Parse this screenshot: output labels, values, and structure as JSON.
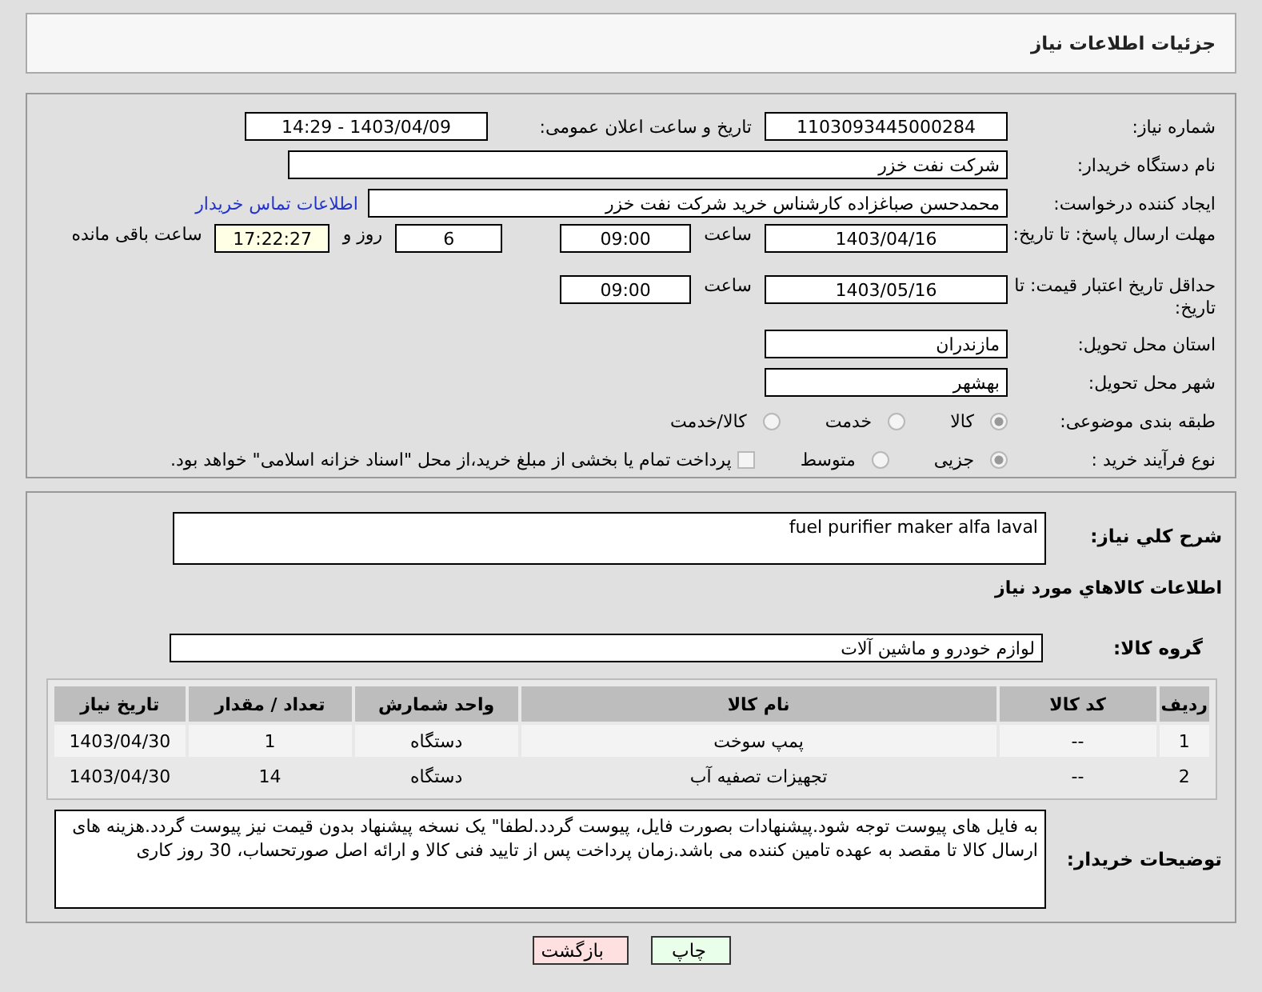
{
  "header": {
    "title": "جزئیات اطلاعات نیاز"
  },
  "need_number": {
    "label": "شماره نیاز:",
    "value": "1103093445000284"
  },
  "announce": {
    "label": "تاریخ و ساعت اعلان عمومی:",
    "value": "1403/04/09 - 14:29"
  },
  "buyer": {
    "label": "نام دستگاه خریدار:",
    "value": "شرکت نفت خزر"
  },
  "creator": {
    "label": "ایجاد کننده درخواست:",
    "value": "محمدحسن صباغزاده کارشناس خرید شرکت نفت خزر",
    "link": "اطلاعات تماس خریدار"
  },
  "reply_deadline": {
    "label": "مهلت ارسال پاسخ: تا تاریخ:",
    "date": "1403/04/16",
    "time_label": "ساعت",
    "time": "09:00",
    "days": "6",
    "days_label": "روز و",
    "remaining": "17:22:27",
    "remaining_label": "ساعت باقی مانده"
  },
  "price_validity": {
    "label": "حداقل تاریخ اعتبار قیمت: تا تاریخ:",
    "date": "1403/05/16",
    "time_label": "ساعت",
    "time": "09:00"
  },
  "province": {
    "label": "استان محل تحویل:",
    "value": "مازندران"
  },
  "city": {
    "label": "شهر محل تحویل:",
    "value": "بهشهر"
  },
  "category": {
    "label": "طبقه بندی موضوعی:",
    "options": [
      {
        "label": "کالا",
        "selected": true
      },
      {
        "label": "خدمت",
        "selected": false
      },
      {
        "label": "کالا/خدمت",
        "selected": false
      }
    ]
  },
  "purchase_type": {
    "label": "نوع فرآیند خرید :",
    "options": [
      {
        "label": "جزیی",
        "selected": true
      },
      {
        "label": "متوسط",
        "selected": false
      }
    ],
    "treasury": {
      "label": "پرداخت تمام یا بخشی از مبلغ خرید،از محل \"اسناد خزانه اسلامی\" خواهد بود.",
      "checked": false
    }
  },
  "description": {
    "label": "شرح کلي نیاز:",
    "value": "fuel purifier maker alfa laval"
  },
  "goods_heading": "اطلاعات کالاهاي مورد نیاز",
  "goods_group": {
    "label": "گروه کالا:",
    "value": "لوازم خودرو و ماشین آلات"
  },
  "table": {
    "columns": [
      "ردیف",
      "کد کالا",
      "نام کالا",
      "واحد شمارش",
      "تعداد / مقدار",
      "تاریخ نیاز"
    ],
    "rows": [
      [
        "1",
        "--",
        "پمپ سوخت",
        "دستگاه",
        "1",
        "1403/04/30"
      ],
      [
        "2",
        "--",
        "تجهیزات تصفیه آب",
        "دستگاه",
        "14",
        "1403/04/30"
      ]
    ]
  },
  "notes": {
    "label": "توضیحات خریدار:",
    "value": "به فایل های پیوست توجه شود.پیشنهادات  بصورت فایل، پیوست گردد.لطفا\" یک نسخه پیشنهاد بدون قیمت نیز پیوست گردد.هزینه های ارسال کالا تا مقصد به عهده تامین کننده می باشد.زمان پرداخت پس از تایید فنی کالا و ارائه اصل صورتحساب، 30 روز کاری"
  },
  "buttons": [
    {
      "label": "چاپ",
      "kind": "print"
    },
    {
      "label": "بازگشت",
      "kind": "back"
    }
  ]
}
